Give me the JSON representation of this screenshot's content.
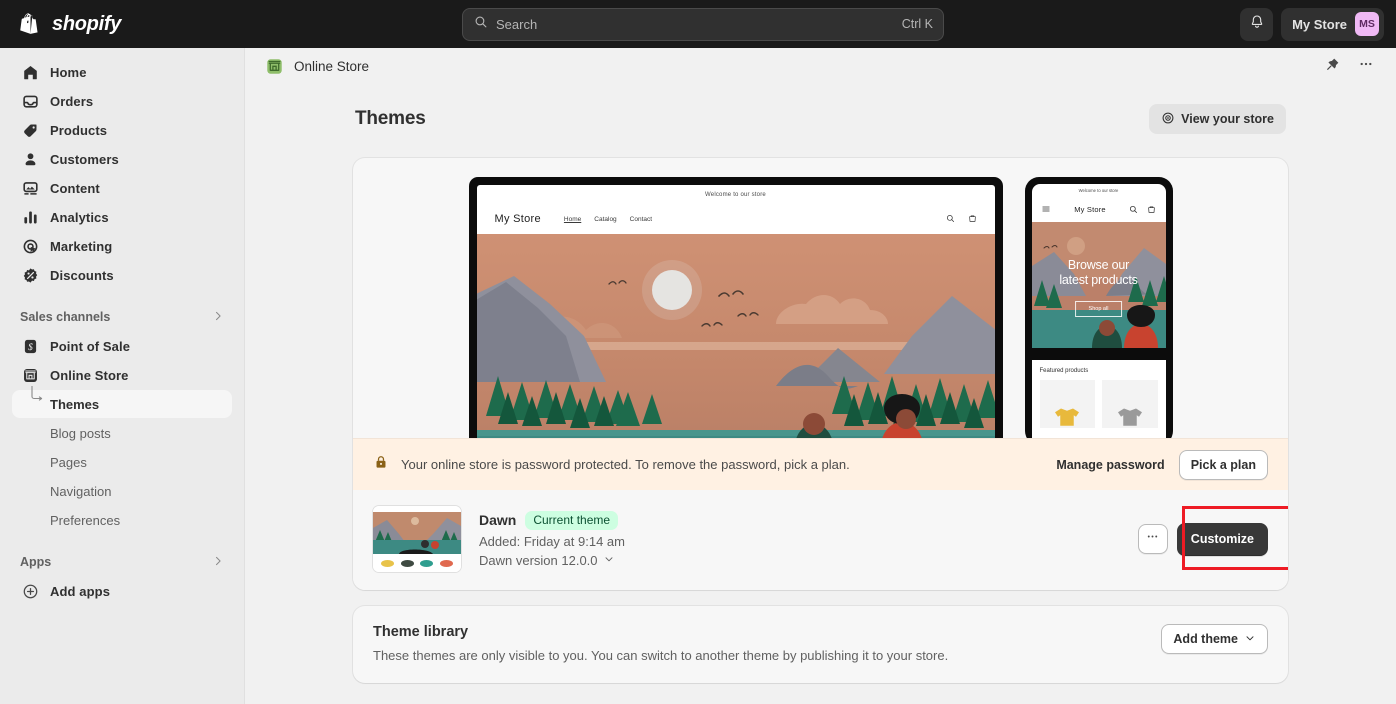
{
  "topbar": {
    "brand": "shopify",
    "brand_logo_icon": "shopify-bag-logo",
    "search": {
      "placeholder": "Search",
      "value": "",
      "shortcut": "Ctrl K",
      "icon": "search-icon"
    },
    "notifications_icon": "bell-icon",
    "store_name": "My Store",
    "avatar_initials": "MS",
    "avatar_color": "#f0b9f5"
  },
  "sidebar": {
    "items": [
      {
        "label": "Home",
        "icon": "home-icon"
      },
      {
        "label": "Orders",
        "icon": "orders-inbox-icon"
      },
      {
        "label": "Products",
        "icon": "product-tag-icon"
      },
      {
        "label": "Customers",
        "icon": "person-icon"
      },
      {
        "label": "Content",
        "icon": "content-image-icon"
      },
      {
        "label": "Analytics",
        "icon": "bar-chart-icon"
      },
      {
        "label": "Marketing",
        "icon": "marketing-target-icon"
      },
      {
        "label": "Discounts",
        "icon": "discount-badge-icon"
      }
    ],
    "sections": [
      {
        "label": "Sales channels",
        "chevron_icon": "chevron-right-icon"
      },
      {
        "label": "Apps",
        "chevron_icon": "chevron-right-icon"
      }
    ],
    "channels": [
      {
        "label": "Point of Sale",
        "icon": "point-of-sale-icon"
      },
      {
        "label": "Online Store",
        "icon": "online-store-icon"
      }
    ],
    "online_store_subitems": [
      {
        "label": "Themes",
        "active": true
      },
      {
        "label": "Blog posts",
        "active": false
      },
      {
        "label": "Pages",
        "active": false
      },
      {
        "label": "Navigation",
        "active": false
      },
      {
        "label": "Preferences",
        "active": false
      }
    ],
    "add_apps": {
      "label": "Add apps",
      "icon": "plus-circle-icon"
    }
  },
  "page_header": {
    "icon": "online-store-green-icon",
    "title": "Online Store",
    "pin_icon": "pin-icon",
    "more_icon": "more-horizontal-icon"
  },
  "page": {
    "title": "Themes",
    "view_store_button": {
      "label": "View your store",
      "icon": "view-eye-icon"
    }
  },
  "preview": {
    "desktop": {
      "announcement": "Welcome to our store",
      "logo": "My Store",
      "nav_links": [
        "Home",
        "Catalog",
        "Contact"
      ],
      "current_link": "Home",
      "search_icon": "search-icon",
      "cart_icon": "cart-icon"
    },
    "mobile": {
      "announcement": "Welcome to our store",
      "menu_icon": "hamburger-menu-icon",
      "logo": "My Store",
      "search_icon": "search-icon",
      "cart_icon": "cart-icon",
      "hero_heading_line1": "Browse our",
      "hero_heading_line2": "latest products",
      "hero_button": "Shop all",
      "featured_title": "Featured products"
    },
    "colors": {
      "sky": "#c98f6f",
      "sky_top": "#d39775",
      "mountain": "#8a8b96",
      "mountain_dark": "#6e7280",
      "pine": "#1f6b4e",
      "water": "#3f8c84",
      "sun": "#e8e8e8"
    }
  },
  "banner": {
    "icon": "lock-icon",
    "message": "Your online store is password protected. To remove the password, pick a plan.",
    "manage_label": "Manage password",
    "plan_button": "Pick a plan",
    "background": "#fff1e3"
  },
  "theme": {
    "name": "Dawn",
    "badge": "Current theme",
    "badge_bg": "#cdfee1",
    "badge_color": "#0c5132",
    "added": "Added: Friday at 9:14 am",
    "version": "Dawn version 12.0.0",
    "version_chevron_icon": "chevron-down-icon",
    "more_icon": "more-horizontal-icon",
    "customize_button": "Customize",
    "highlight_color": "#ee1b24",
    "thumbnail_swatches": [
      "#e8c34a",
      "#3f4a42",
      "#2f9e8f",
      "#e0694f"
    ]
  },
  "library": {
    "title": "Theme library",
    "description": "These themes are only visible to you. You can switch to another theme by publishing it to your store.",
    "add_theme_button": "Add theme",
    "add_theme_chevron_icon": "chevron-down-icon"
  },
  "watermark": {
    "text": ""
  }
}
